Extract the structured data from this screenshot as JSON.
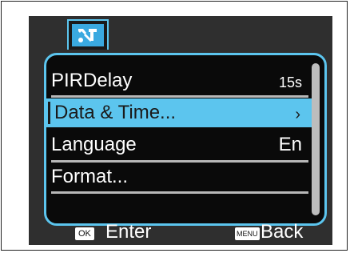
{
  "colors": {
    "accent": "#5cc5ee",
    "screen_bg": "#2f2f2f",
    "panel_bg": "#0a0a0a",
    "text": "#ffffff"
  },
  "tab": {
    "icon": "wrench-settings-icon"
  },
  "menu": {
    "items": [
      {
        "label": "PIRDelay",
        "value": "15s"
      },
      {
        "label": "Data & Time...",
        "value": "›"
      },
      {
        "label": "Language",
        "value": "En"
      },
      {
        "label": "Format...",
        "value": ""
      }
    ],
    "selected_index": 1
  },
  "footer": {
    "ok_key": "OK",
    "ok_action": "Enter",
    "menu_key": "MENU",
    "menu_action": "Back"
  }
}
